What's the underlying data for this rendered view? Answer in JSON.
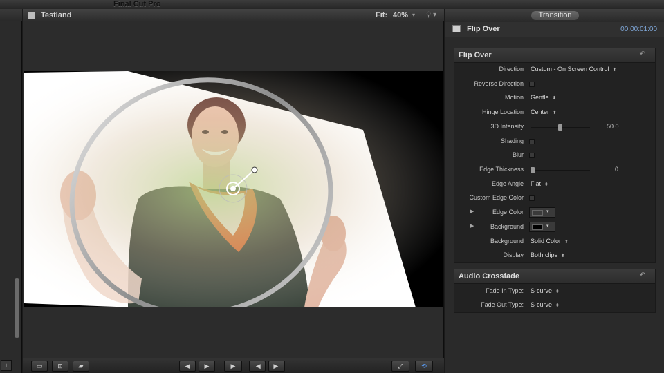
{
  "app": {
    "title": "Final Cut Pro"
  },
  "viewer": {
    "clip_title": "Testland",
    "fit_label": "Fit:",
    "fit_value": "40%",
    "fit_chevron": "▾",
    "options_glyph": "⚲ ▾"
  },
  "transport": {
    "buttons": [
      {
        "name": "view-options-button",
        "glyph": "▭"
      },
      {
        "name": "transform-button",
        "glyph": "⊡"
      },
      {
        "name": "crop-button",
        "glyph": "▰"
      },
      {
        "name": "previous-frame-button",
        "glyph": "◀"
      },
      {
        "name": "next-frame-button",
        "glyph": "▶"
      },
      {
        "name": "play-button",
        "glyph": "▶"
      },
      {
        "name": "go-to-start-button",
        "glyph": "|◀"
      },
      {
        "name": "go-to-end-button",
        "glyph": "▶|"
      },
      {
        "name": "fullscreen-button",
        "glyph": "⤢"
      },
      {
        "name": "loop-button",
        "glyph": "⟲"
      }
    ]
  },
  "left_strip": {
    "button_glyph": "i"
  },
  "inspector": {
    "tab_label": "Transition",
    "header_title": "Flip Over",
    "duration": "00:00:01:00",
    "flip_over": {
      "title": "Flip Over",
      "reset_glyph": "↶",
      "direction": {
        "label": "Direction",
        "value": "Custom - On Screen Control",
        "arrows": "⬍"
      },
      "reverse_direction": {
        "label": "Reverse Direction"
      },
      "motion": {
        "label": "Motion",
        "value": "Gentle",
        "arrows": "⬍"
      },
      "hinge_location": {
        "label": "Hinge Location",
        "value": "Center",
        "arrows": "⬍"
      },
      "intensity_3d": {
        "label": "3D Intensity",
        "value": "50.0",
        "fraction": 0.5
      },
      "shading": {
        "label": "Shading"
      },
      "blur": {
        "label": "Blur"
      },
      "edge_thickness": {
        "label": "Edge Thickness",
        "value": "0",
        "fraction": 0
      },
      "edge_angle": {
        "label": "Edge Angle",
        "value": "Flat",
        "arrows": "⬍"
      },
      "custom_edge_color": {
        "label": "Custom Edge Color"
      },
      "edge_color": {
        "label": "Edge Color",
        "disclosure": "▶",
        "color": "#3a3a3a",
        "arrow": "▾"
      },
      "background_color": {
        "label": "Background",
        "disclosure": "▶",
        "color": "#000000",
        "arrow": "▾"
      },
      "background": {
        "label": "Background",
        "value": "Solid Color",
        "arrows": "⬍"
      },
      "display": {
        "label": "Display",
        "value": "Both clips",
        "arrows": "⬍"
      }
    },
    "audio_crossfade": {
      "title": "Audio Crossfade",
      "reset_glyph": "↶",
      "fade_in": {
        "label": "Fade In Type:",
        "value": "S-curve",
        "arrows": "⬍"
      },
      "fade_out": {
        "label": "Fade Out Type:",
        "value": "S-curve",
        "arrows": "⬍"
      }
    }
  },
  "colors": {
    "accent_blue": "#7fa7d8",
    "scarf_orange": "#d9652a",
    "top_dark": "#2f3a31"
  }
}
